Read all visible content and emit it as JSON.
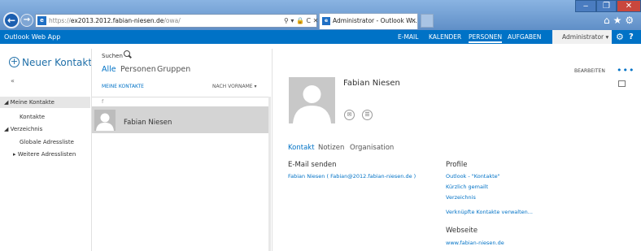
{
  "browser": {
    "window_buttons": {
      "minimize": "‒",
      "maximize": "❐",
      "close": "✕"
    },
    "back_glyph": "←",
    "forward_glyph": "→",
    "url_prefix": "https://",
    "url_host": "ex2013.2012.fabian-niesen.de",
    "url_path": "/owa/",
    "address_tools": "⚲ ▾ 🔒 C ✕",
    "tab_title": "Administrator - Outlook W...",
    "tab_close": "✕",
    "toolbar_icons": "⌂★⚙",
    "site_icon": "e",
    "tab_icon": "e"
  },
  "app": {
    "title": "Outlook Web App",
    "nav": [
      "E-MAIL",
      "KALENDER",
      "PERSONEN",
      "AUFGABEN"
    ],
    "user": "Administrator ▾",
    "gear_icon": "⚙",
    "help_icon": "?"
  },
  "left": {
    "new_contact": "Neuer Kontakt",
    "new_contact_icon": "+",
    "collapse": "«",
    "tree": [
      {
        "label": "◢ Meine Kontakte"
      },
      {
        "label": "Kontakte"
      },
      {
        "label": "◢ Verzeichnis"
      },
      {
        "label": "Globale Adressliste"
      },
      {
        "label": "▸ Weitere Adresslisten"
      }
    ]
  },
  "middle": {
    "search_label": "Suchen",
    "filters": [
      "Alle",
      "Personen",
      "Gruppen"
    ],
    "active_filter": "Alle",
    "list_title": "MEINE KONTAKTE",
    "sort": "NACH VORNAME ▾",
    "group_header": "f",
    "contacts": [
      {
        "name": "Fabian Niesen"
      }
    ]
  },
  "detail": {
    "name": "Fabian Niesen",
    "edit": "BEARBEITEN",
    "more": "•••",
    "mail_icon": "✉",
    "chat_icon": "☰",
    "tabs": [
      "Kontakt",
      "Notizen",
      "Organisation"
    ],
    "active_tab": "Kontakt",
    "email_heading": "E-Mail senden",
    "email_value": "Fabian Niesen ( Fabian@2012.fabian-niesen.de )",
    "profile_heading": "Profile",
    "profile_links": [
      "Outlook - \"Kontakte\"",
      "Kürzlich gemailt",
      "Verzeichnis",
      "Verknüpfte Kontakte verwalten..."
    ],
    "website_heading": "Webseite",
    "website_value": "www.fabian-niesen.de"
  },
  "colors": {
    "accent": "#0072c6",
    "selected_row": "#d4d4d4"
  }
}
